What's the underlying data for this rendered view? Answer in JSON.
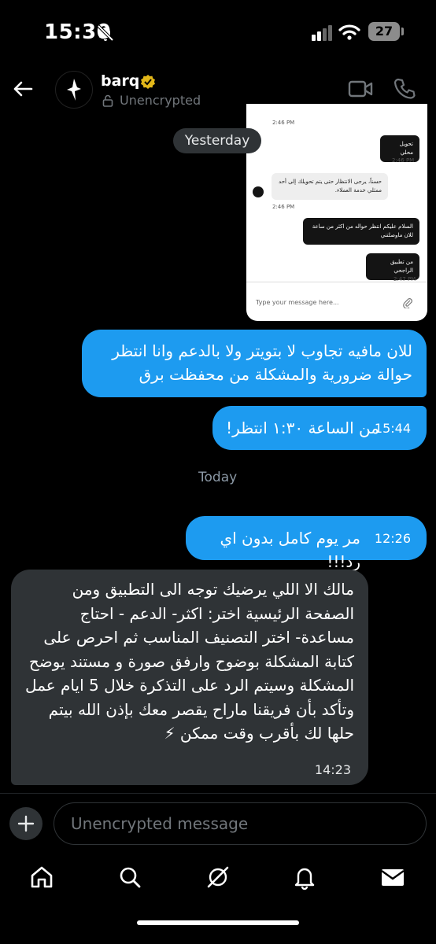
{
  "status_bar": {
    "time": "15:30",
    "battery": "27"
  },
  "header": {
    "name": "barq",
    "encryption": "Unencrypted"
  },
  "shared_screenshot": {
    "times": [
      "2:46 PM",
      "2:46 PM",
      "2:46 PM",
      "2:47 PM"
    ],
    "messages": [
      "تحويل محلي",
      "حسناً، يرجى الانتظار حتى يتم تحويلك إلى أحد ممثلي خدمة العملاء.",
      "السلام عليكم انتظر حواله من اكثر من ساعة للان ماوصلتني",
      "من تطبيق الراجحي"
    ],
    "input_placeholder": "Type your message here..."
  },
  "dividers": {
    "yesterday": "Yesterday",
    "today": "Today"
  },
  "messages": [
    {
      "text": "للان مافيه تجاوب لا بتويتر ولا بالدعم وانا انتظر حوالة ضرورية والمشكلة من محفظت برق",
      "time": ""
    },
    {
      "text": "من الساعة ١:٣٠ انتظر!",
      "time": "15:44"
    },
    {
      "text": "مر يوم كامل بدون اي رد!!!",
      "time": "12:26"
    },
    {
      "text": "مالك الا اللي يرضيك توجه الى التطبيق ومن الصفحة الرئيسية اختر: اكثر- الدعم - احتاج مساعدة- اختر التصنيف المناسب ثم احرص على كتابة المشكلة بوضوح وارفق صورة و مستند يوضح المشكلة وسيتم الرد على التذكرة خلال 5 ايام عمل وتأكد بأن فريقنا ماراح يقصر معك بإذن الله بيتم حلها لك بأقرب وقت ممكن ⚡",
      "time": "14:23"
    }
  ],
  "composer": {
    "placeholder": "Unencrypted message"
  },
  "colors": {
    "sent": "#1d9bf0",
    "received": "#2f3336",
    "verified": "#e2b719"
  },
  "icons": [
    "back-icon",
    "verified-icon",
    "lock-icon",
    "video-icon",
    "phone-icon",
    "plus-icon",
    "home-icon",
    "search-icon",
    "grok-icon",
    "bell-icon",
    "mail-icon"
  ]
}
